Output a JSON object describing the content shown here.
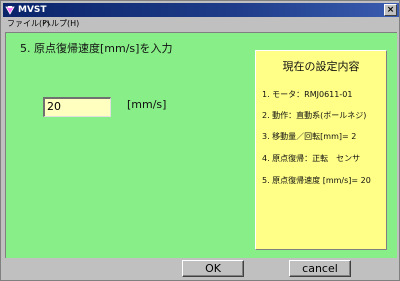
{
  "window": {
    "title": "MVST",
    "close_glyph": "×"
  },
  "menu": {
    "items": [
      "ファイル(F)",
      "ヘルプ(H)"
    ]
  },
  "main": {
    "prompt": "5. 原点復帰速度[mm/s]を入力",
    "input_value": "20",
    "unit": "[mm/s]"
  },
  "settings": {
    "title": "現在の設定内容",
    "items": [
      "1. モータ：RMJ0611-01",
      "2. 動作：直動系(ボールネジ)",
      "3. 移動量／回転[mm]= 2",
      "4. 原点復帰：正転　センサ",
      "5. 原点復帰速度 [mm/s]= 20"
    ]
  },
  "buttons": {
    "ok": "OK",
    "cancel": "cancel"
  },
  "colors": {
    "content_bg": "#88ee88",
    "panel_bg": "#ffff88",
    "input_bg": "#ffffc0",
    "titlebar": "#0a246a"
  }
}
